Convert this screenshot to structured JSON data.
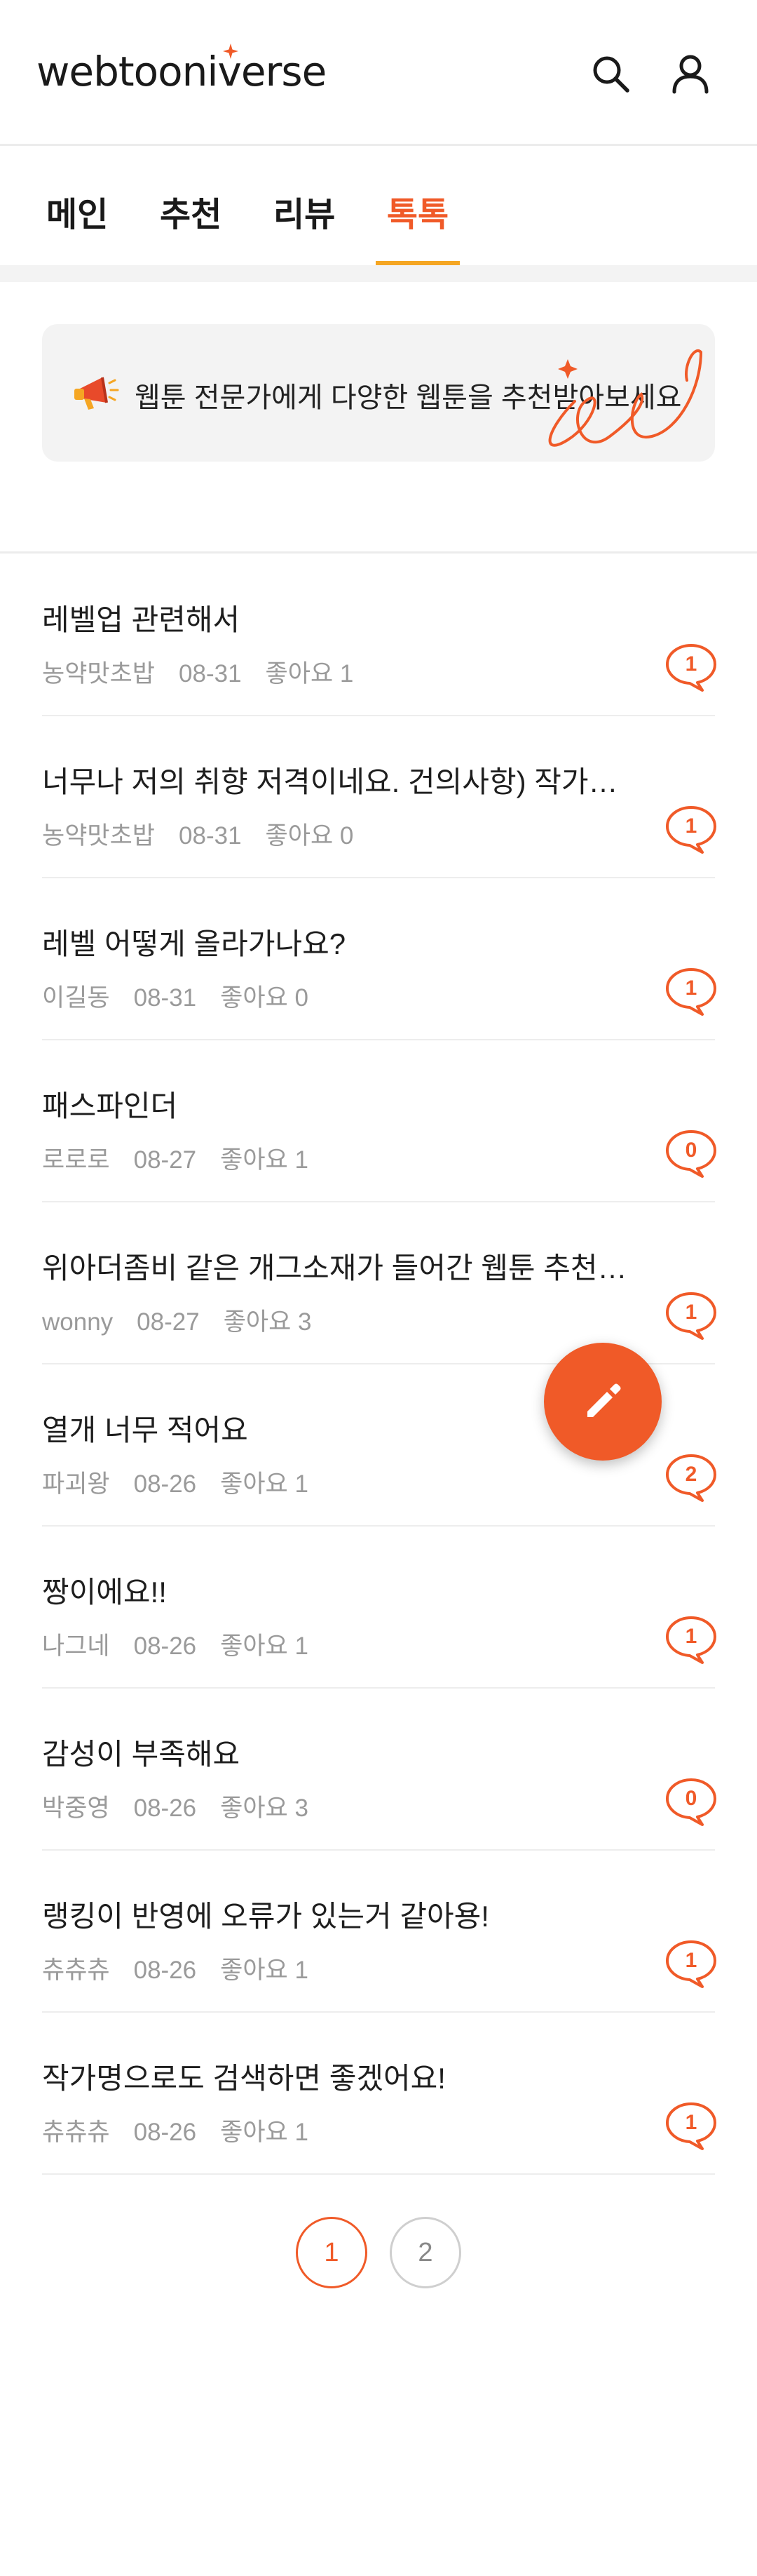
{
  "header": {
    "logo": "webtooniverse",
    "icons": [
      "search-icon",
      "user-icon"
    ]
  },
  "tabs": [
    {
      "label": "메인",
      "active": false
    },
    {
      "label": "추천",
      "active": false
    },
    {
      "label": "리뷰",
      "active": false
    },
    {
      "label": "톡톡",
      "active": true
    }
  ],
  "banner": {
    "icon": "megaphone-icon",
    "text": "웹툰 전문가에게 다양한 웹툰을 추천받아보세요"
  },
  "posts": [
    {
      "title": "레벨업 관련해서",
      "author": "농약맛초밥",
      "date": "08-31",
      "likes": "좋아요 1",
      "comments": "1"
    },
    {
      "title": "너무나 저의 취향 저격이네요. 건의사항) 작가별…",
      "author": "농약맛초밥",
      "date": "08-31",
      "likes": "좋아요 0",
      "comments": "1"
    },
    {
      "title": "레벨 어떻게 올라가나요?",
      "author": "이길동",
      "date": "08-31",
      "likes": "좋아요 0",
      "comments": "1"
    },
    {
      "title": "패스파인더",
      "author": "로로로",
      "date": "08-27",
      "likes": "좋아요 1",
      "comments": "0"
    },
    {
      "title": "위아더좀비 같은 개그소재가 들어간 웹툰 추천…",
      "author": "wonny",
      "date": "08-27",
      "likes": "좋아요 3",
      "comments": "1"
    },
    {
      "title": "열개 너무 적어요",
      "author": "파괴왕",
      "date": "08-26",
      "likes": "좋아요 1",
      "comments": "2"
    },
    {
      "title": "짱이에요!!",
      "author": "나그네",
      "date": "08-26",
      "likes": "좋아요 1",
      "comments": "1"
    },
    {
      "title": "감성이 부족해요",
      "author": "박중영",
      "date": "08-26",
      "likes": "좋아요 3",
      "comments": "0"
    },
    {
      "title": "랭킹이 반영에 오류가 있는거 같아용!",
      "author": "츄츄츄",
      "date": "08-26",
      "likes": "좋아요 1",
      "comments": "1"
    },
    {
      "title": "작가명으로도 검색하면 좋겠어요!",
      "author": "츄츄츄",
      "date": "08-26",
      "likes": "좋아요 1",
      "comments": "1"
    }
  ],
  "fab": {
    "icon": "pencil-icon"
  },
  "pagination": {
    "pages": [
      "1",
      "2"
    ],
    "current": "1"
  },
  "colors": {
    "accent": "#f05a28",
    "tab_underline": "#f5a623",
    "meta_text": "#9a9a9a"
  }
}
